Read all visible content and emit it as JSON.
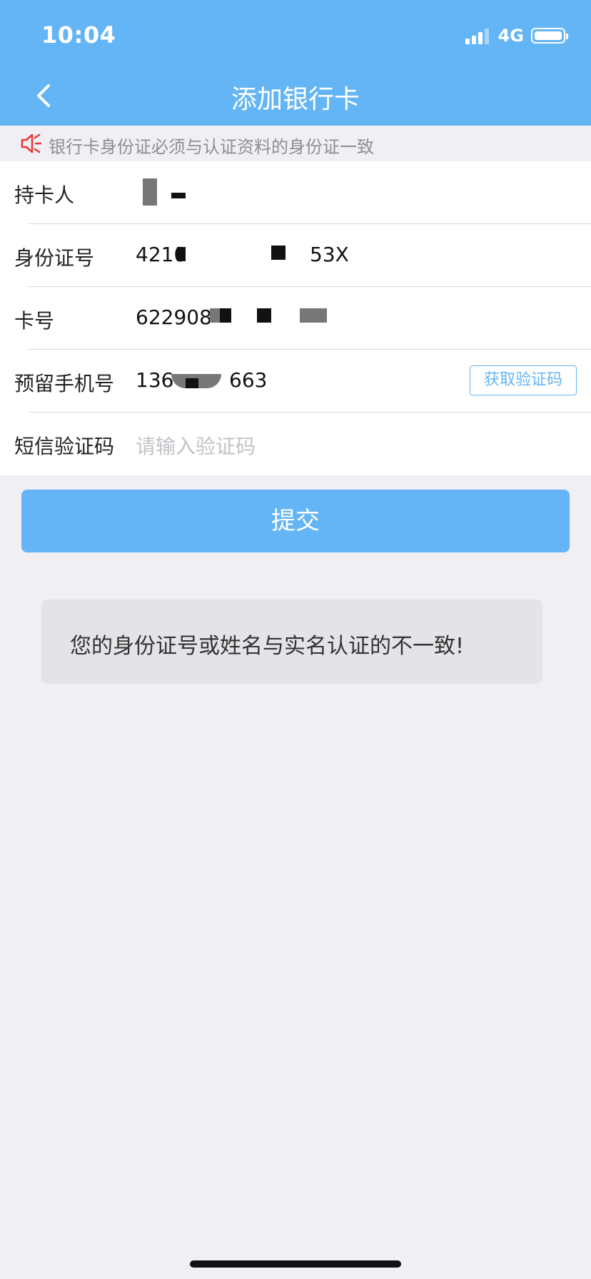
{
  "status_bar": {
    "time": "10:04",
    "network": "4G"
  },
  "nav": {
    "title": "添加银行卡"
  },
  "notice": {
    "text": "银行卡身份证必须与认证资料的身份证一致"
  },
  "form": {
    "rows": [
      {
        "label": "持卡人",
        "value": ""
      },
      {
        "label": "身份证号",
        "value_prefix": "4210",
        "value_suffix": "53X"
      },
      {
        "label": "卡号",
        "value_prefix": "622908"
      },
      {
        "label": "预留手机号",
        "value_prefix": "136",
        "value_suffix": "663",
        "code_button": "获取验证码"
      },
      {
        "label": "短信验证码",
        "placeholder": "请输入验证码"
      }
    ]
  },
  "submit": {
    "label": "提交"
  },
  "toast": {
    "text": "您的身份证号或姓名与实名认证的不一致!"
  },
  "colors": {
    "primary": "#64b5f6",
    "background": "#efeff4",
    "notice_icon": "#e53935"
  }
}
